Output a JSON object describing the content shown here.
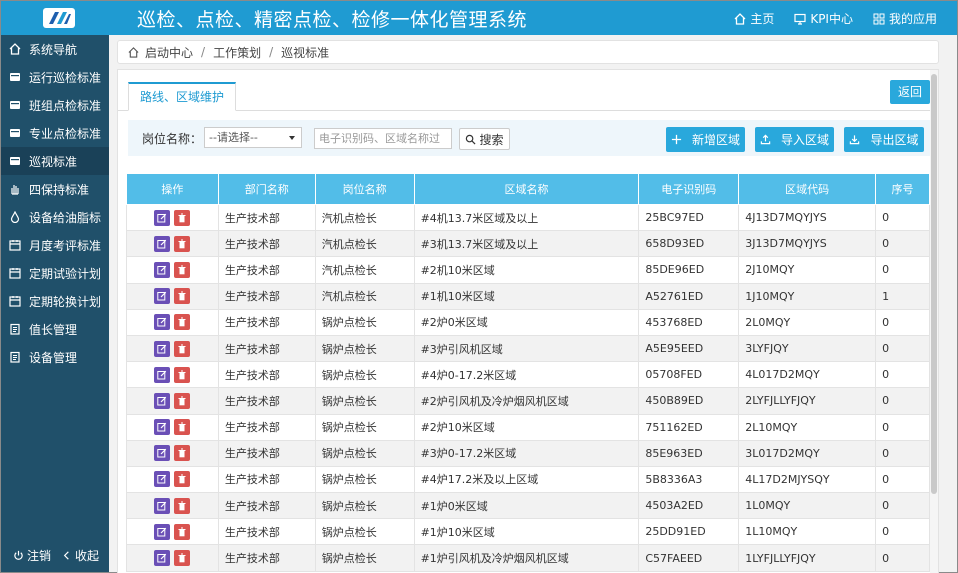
{
  "app": {
    "title": "巡检、点检、精密点检、检修一体化管理系统"
  },
  "top_nav": [
    {
      "label": "主页",
      "icon": "home-icon"
    },
    {
      "label": "KPI中心",
      "icon": "monitor-icon"
    },
    {
      "label": "我的应用",
      "icon": "apps-icon"
    }
  ],
  "sidebar": {
    "items": [
      {
        "label": "系统导航",
        "icon": "home-icon"
      },
      {
        "label": "运行巡检标准",
        "icon": "card-icon"
      },
      {
        "label": "班组点检标准",
        "icon": "card-icon"
      },
      {
        "label": "专业点检标准",
        "icon": "card-icon"
      },
      {
        "label": "巡视标准",
        "icon": "card-icon",
        "active": true
      },
      {
        "label": "四保持标准",
        "icon": "hand-icon"
      },
      {
        "label": "设备给油脂标",
        "icon": "drop-icon"
      },
      {
        "label": "月度考评标准",
        "icon": "calendar-icon"
      },
      {
        "label": "定期试验计划",
        "icon": "calendar-icon"
      },
      {
        "label": "定期轮换计划",
        "icon": "calendar-icon"
      },
      {
        "label": "值长管理",
        "icon": "clipboard-icon"
      },
      {
        "label": "设备管理",
        "icon": "clipboard-icon"
      }
    ],
    "logout_label": "注销",
    "collapse_label": "收起"
  },
  "breadcrumb": {
    "items": [
      "启动中心",
      "工作策划",
      "巡视标准"
    ]
  },
  "tab": {
    "label": "路线、区域维护"
  },
  "back_label": "返回",
  "filter": {
    "post_label": "岗位名称：",
    "post_select": "--请选择--",
    "search_placeholder": "电子识别码、区域名称过",
    "search_label": "搜索"
  },
  "actions": {
    "add": "新增区域",
    "import": "导入区域",
    "export": "导出区域"
  },
  "table": {
    "columns": [
      "操作",
      "部门名称",
      "岗位名称",
      "区域名称",
      "电子识别码",
      "区域代码",
      "序号"
    ],
    "rows": [
      [
        "生产技术部",
        "汽机点检长",
        "#4机13.7米区域及以上",
        "25BC97ED",
        "4J13D7MQYJYS",
        "0"
      ],
      [
        "生产技术部",
        "汽机点检长",
        "#3机13.7米区域及以上",
        "658D93ED",
        "3J13D7MQYJYS",
        "0"
      ],
      [
        "生产技术部",
        "汽机点检长",
        "#2机10米区域",
        "85DE96ED",
        "2J10MQY",
        "0"
      ],
      [
        "生产技术部",
        "汽机点检长",
        "#1机10米区域",
        "A52761ED",
        "1J10MQY",
        "1"
      ],
      [
        "生产技术部",
        "锅炉点检长",
        "#2炉0米区域",
        "453768ED",
        "2L0MQY",
        "0"
      ],
      [
        "生产技术部",
        "锅炉点检长",
        "#3炉引风机区域",
        "A5E95EED",
        "3LYFJQY",
        "0"
      ],
      [
        "生产技术部",
        "锅炉点检长",
        "#4炉0-17.2米区域",
        "05708FED",
        "4L017D2MQY",
        "0"
      ],
      [
        "生产技术部",
        "锅炉点检长",
        "#2炉引风机及冷炉烟风机区域",
        "450B89ED",
        "2LYFJLLYFJQY",
        "0"
      ],
      [
        "生产技术部",
        "锅炉点检长",
        "#2炉10米区域",
        "751162ED",
        "2L10MQY",
        "0"
      ],
      [
        "生产技术部",
        "锅炉点检长",
        "#3炉0-17.2米区域",
        "85E963ED",
        "3L017D2MQY",
        "0"
      ],
      [
        "生产技术部",
        "锅炉点检长",
        "#4炉17.2米及以上区域",
        "5B8336A3",
        "4L17D2MJYSQY",
        "0"
      ],
      [
        "生产技术部",
        "锅炉点检长",
        "#1炉0米区域",
        "4503A2ED",
        "1L0MQY",
        "0"
      ],
      [
        "生产技术部",
        "锅炉点检长",
        "#1炉10米区域",
        "25DD91ED",
        "1L10MQY",
        "0"
      ],
      [
        "生产技术部",
        "锅炉点检长",
        "#1炉引风机及冷炉烟风机区域",
        "C57FAEED",
        "1LYFJLLYFJQY",
        "0"
      ]
    ]
  },
  "colors": {
    "accent": "#1f9bd2",
    "sidebar": "#20506a",
    "header": "#52bde8",
    "edit": "#6a4fb6",
    "delete": "#d9534f"
  }
}
